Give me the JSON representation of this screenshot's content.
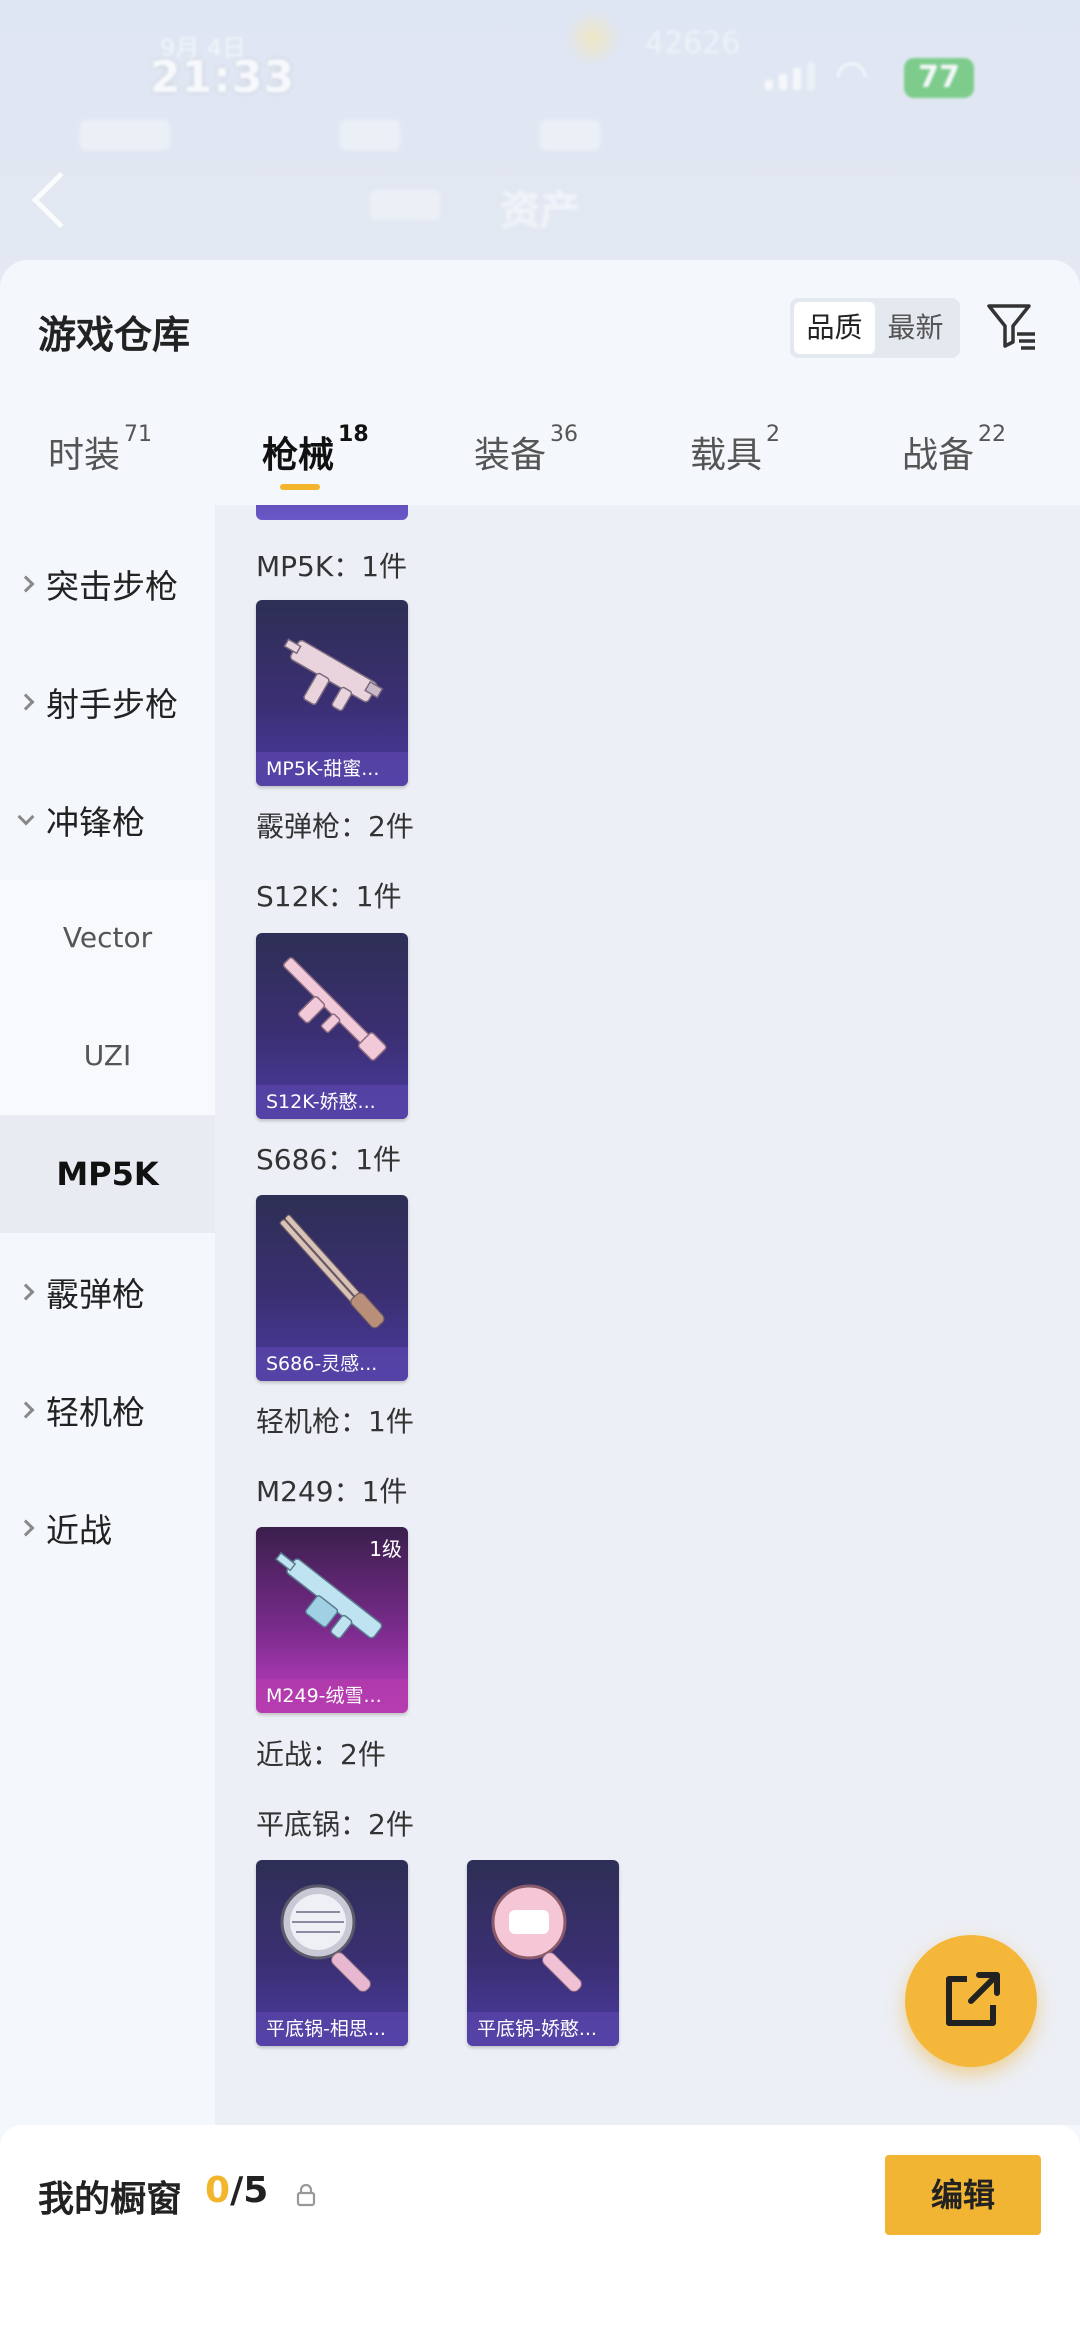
{
  "status_bar": {
    "time": "21:33",
    "date": "9月 4日",
    "middle_text": "42626",
    "battery": "77"
  },
  "background": {
    "title": "资产"
  },
  "sheet": {
    "title": "游戏仓库",
    "sort_options": [
      "品质",
      "最新"
    ],
    "sort_active": "品质",
    "tabs": [
      {
        "label": "时装",
        "count": "71"
      },
      {
        "label": "枪械",
        "count": "18"
      },
      {
        "label": "装备",
        "count": "36"
      },
      {
        "label": "载具",
        "count": "2"
      },
      {
        "label": "战备",
        "count": "22"
      }
    ],
    "active_tab": "枪械"
  },
  "side_nav": {
    "items": [
      {
        "label": "突击步枪",
        "expanded": false
      },
      {
        "label": "射手步枪",
        "expanded": false
      },
      {
        "label": "冲锋枪",
        "expanded": true
      },
      {
        "label": "霰弹枪",
        "expanded": false
      },
      {
        "label": "轻机枪",
        "expanded": false
      },
      {
        "label": "近战",
        "expanded": false
      }
    ],
    "sub_items": [
      "Vector",
      "UZI",
      "MP5K"
    ],
    "selected_sub": "MP5K"
  },
  "content": {
    "labels": {
      "mp5k": "MP5K：1件",
      "shotgun": "霰弹枪：2件",
      "s12k": "S12K：1件",
      "s686": "S686：1件",
      "lmg": "轻机枪：1件",
      "m249": "M249：1件",
      "melee": "近战：2件",
      "pan": "平底锅：2件"
    },
    "cards": {
      "mp5k": {
        "name": "MP5K-甜蜜...",
        "icon": "smg-icon"
      },
      "s12k": {
        "name": "S12K-娇憨...",
        "icon": "shotgun-icon"
      },
      "s686": {
        "name": "S686-灵感...",
        "icon": "double-barrel-icon"
      },
      "m249": {
        "name": "M249-绒雪...",
        "level": "1级",
        "icon": "lmg-icon"
      },
      "pan1": {
        "name": "平底锅-相思...",
        "icon": "pan-icon"
      },
      "pan2": {
        "name": "平底锅-娇憨...",
        "icon": "pan-icon"
      }
    }
  },
  "bottom_bar": {
    "label": "我的橱窗",
    "current": "0",
    "total": "/5",
    "edit_label": "编辑"
  },
  "colors": {
    "accent": "#f2b52c",
    "card_purple": "#3b2f73",
    "card_pink": "#c13fc4"
  }
}
